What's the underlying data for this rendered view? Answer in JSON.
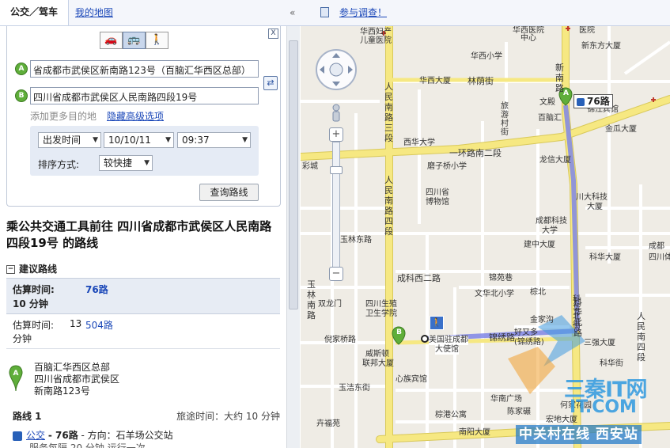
{
  "topbar": {
    "tab_transit": "公交／驾车",
    "tab_mymaps": "我的地图",
    "collapse_glyph": "«",
    "survey_link": "参与调查！"
  },
  "form": {
    "close_glyph": "X",
    "modes": [
      {
        "name": "drive",
        "glyph": "🚗",
        "selected": false
      },
      {
        "name": "transit",
        "glyph": "🚌",
        "selected": true
      },
      {
        "name": "walk",
        "glyph": "🚶",
        "selected": false
      }
    ],
    "marker_a": "A",
    "marker_b": "B",
    "start_value": "省成都市武侯区新南路123号（百脑汇华西区总部）",
    "end_value": "四川省成都市武侯区人民南路四段19号",
    "add_destination": "添加更多目的地",
    "advanced_options": "隐藏高级选项",
    "time_type": "出发时间",
    "date": "10/10/11",
    "time": "09:37",
    "sort_label": "排序方式:",
    "sort_value": "较快捷",
    "search_button": "查询路线"
  },
  "results": {
    "heading": "乘公共交通工具前往 四川省成都市武侯区人民南路四段19号 的路线",
    "suggest_label": "建议路线",
    "suggest_box": "−",
    "routes": [
      {
        "time_label": "估算时间:",
        "time_value": "10 分钟",
        "line": "76路"
      },
      {
        "time_label": "估算时间:",
        "time_value_a": "13",
        "time_value_b": "分钟",
        "line": "504路"
      }
    ],
    "start_pin": "A",
    "start_addr": [
      "百脑汇华西区总部",
      "四川省成都市武侯区",
      "新南路123号"
    ],
    "route_label": "路线 1",
    "travel_time": "旅途时间：大约 10 分钟",
    "bus_link": "公交",
    "bus_line": "- 76路",
    "bus_dir": "- 方向：石羊场公交站",
    "service": "服务每隔 20 分钟 运行一次"
  },
  "map": {
    "labels": [
      {
        "t": "华西妇产",
        "c": "lbl"
      },
      {
        "t": "儿童医院",
        "c": "lbl"
      },
      {
        "t": "华西医院",
        "c": "lbl"
      },
      {
        "t": "中心",
        "c": "lbl"
      },
      {
        "t": "医院",
        "c": "lbl"
      },
      {
        "t": "新东方大厦",
        "c": "lbl"
      },
      {
        "t": "华西小学",
        "c": "lbl"
      },
      {
        "t": "华西大厦",
        "c": "lbl"
      },
      {
        "t": "旅游村街",
        "c": "lbl v"
      },
      {
        "t": "百脑汇",
        "c": "lbl"
      },
      {
        "t": "文殿",
        "c": "lbl"
      },
      {
        "t": "锦江宾馆",
        "c": "lbl"
      },
      {
        "t": "金瓜大厦",
        "c": "lbl"
      },
      {
        "t": "西华大学",
        "c": "lbl"
      },
      {
        "t": "磨子桥小学",
        "c": "lbl"
      },
      {
        "t": "龙信大厦",
        "c": "lbl"
      },
      {
        "t": "四川省",
        "c": "lbl"
      },
      {
        "t": "博物馆",
        "c": "lbl"
      },
      {
        "t": "川大科技",
        "c": "lbl"
      },
      {
        "t": "大厦",
        "c": "lbl"
      },
      {
        "t": "成都科技",
        "c": "lbl"
      },
      {
        "t": "大学",
        "c": "lbl"
      },
      {
        "t": "建中大厦",
        "c": "lbl"
      },
      {
        "t": "玉林东路",
        "c": "lbl"
      },
      {
        "t": "科华大厦",
        "c": "lbl"
      },
      {
        "t": "锦苑巷",
        "c": "lbl"
      },
      {
        "t": "文华北小学",
        "c": "lbl"
      },
      {
        "t": "双龙门",
        "c": "lbl"
      },
      {
        "t": "四川生殖",
        "c": "lbl"
      },
      {
        "t": "卫生学院",
        "c": "lbl"
      },
      {
        "t": "倪家桥路",
        "c": "lbl"
      },
      {
        "t": "美国驻成都",
        "c": "lbl"
      },
      {
        "t": "大使馆",
        "c": "lbl"
      },
      {
        "t": "威斯顿",
        "c": "lbl"
      },
      {
        "t": "联邦大厦",
        "c": "lbl"
      },
      {
        "t": "心族宾馆",
        "c": "lbl"
      },
      {
        "t": "玉洁东街",
        "c": "lbl"
      },
      {
        "t": "科华北街",
        "c": "lbl"
      },
      {
        "t": "好又多",
        "c": "lbl"
      },
      {
        "t": "(锦绣路)",
        "c": "lbl"
      },
      {
        "t": "金家沟",
        "c": "lbl"
      },
      {
        "t": "三强大厦",
        "c": "lbl"
      },
      {
        "t": "华南广场",
        "c": "lbl"
      },
      {
        "t": "陈家碾",
        "c": "lbl"
      },
      {
        "t": "宏地大厦",
        "c": "lbl"
      },
      {
        "t": "棕港公寓",
        "c": "lbl"
      },
      {
        "t": "南阳大厦",
        "c": "lbl"
      },
      {
        "t": "何家花园",
        "c": "lbl"
      },
      {
        "t": "四川体育",
        "c": "lbl"
      },
      {
        "t": "科华街",
        "c": "lbl"
      },
      {
        "t": "棕北",
        "c": "lbl"
      },
      {
        "t": "卉福苑",
        "c": "lbl"
      },
      {
        "t": "彩城",
        "c": "lbl"
      },
      {
        "t": "成都",
        "c": "lbl"
      }
    ],
    "roads": [
      {
        "t": "林荫街"
      },
      {
        "t": "一环路南二段"
      },
      {
        "t": "成科西二路"
      },
      {
        "t": "锦绣路"
      },
      {
        "t": "人民南路三段"
      },
      {
        "t": "人民南路四段"
      },
      {
        "t": "新南路"
      },
      {
        "t": "科华北路"
      },
      {
        "t": "人民南四段"
      },
      {
        "t": "玉林南路"
      }
    ],
    "bus_tag": "76路",
    "pin_a": "A",
    "pin_b": "B",
    "walk_glyph": "🚶",
    "zoom_plus": "+",
    "zoom_minus": "−"
  },
  "watermark": {
    "line1": "三秦IT网",
    "line2": "IT.COM",
    "line3": "中关村在线 西安站"
  },
  "colors": {
    "route": "#7f86e6",
    "marker": "#5fae3a",
    "road_major": "#f6e882",
    "link": "#1a47b8"
  }
}
